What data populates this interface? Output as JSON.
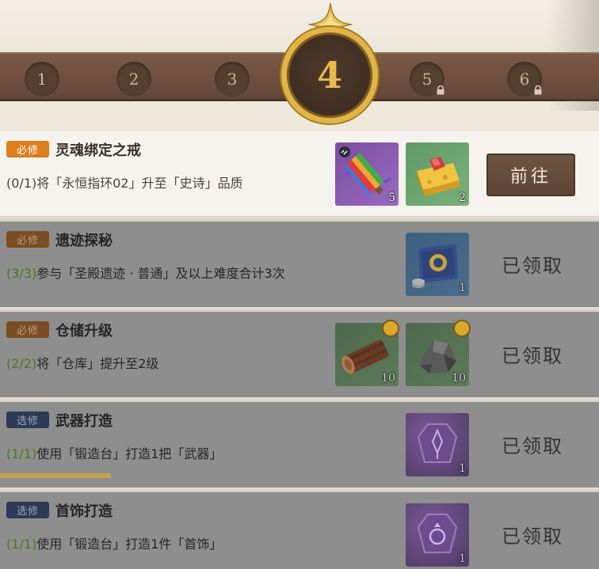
{
  "stages": [
    {
      "label": "1",
      "locked": false
    },
    {
      "label": "2",
      "locked": false
    },
    {
      "label": "3",
      "locked": false
    },
    {
      "label": "4",
      "locked": false,
      "current": true
    },
    {
      "label": "5",
      "locked": true
    },
    {
      "label": "6",
      "locked": true
    }
  ],
  "tasks": [
    {
      "tag": "必修",
      "title": "灵魂绑定之戒",
      "progress": "(0/1)",
      "description": "将「永恒指环02」升至「史诗」品质",
      "rewards": [
        {
          "icon": "rainbow-firework-icon",
          "qty": "5"
        },
        {
          "icon": "cheese-icon",
          "qty": "2"
        }
      ],
      "action": "前往"
    },
    {
      "tag": "必修",
      "title": "遗迹探秘",
      "progress": "(3/3)",
      "description": "参与「圣殿遗迹 · 普通」及以上难度合计3次",
      "rewards": [
        {
          "icon": "blue-banner-icon",
          "qty": "1"
        }
      ],
      "action": "已领取"
    },
    {
      "tag": "必修",
      "title": "仓储升级",
      "progress": "(2/2)",
      "description": "将「仓库」提升至2级",
      "rewards": [
        {
          "icon": "wood-log-icon",
          "qty": "10"
        },
        {
          "icon": "stone-ore-icon",
          "qty": "10"
        }
      ],
      "action": "已领取"
    },
    {
      "tag": "选修",
      "title": "武器打造",
      "progress": "(1/1)",
      "description": "使用「锻造台」打造1把「武器」",
      "rewards": [
        {
          "icon": "purple-weapon-blueprint-icon",
          "qty": "1"
        }
      ],
      "action": "已领取"
    },
    {
      "tag": "选修",
      "title": "首饰打造",
      "progress": "(1/1)",
      "description": "使用「锻造台」打造1件「首饰」",
      "rewards": [
        {
          "icon": "purple-jewelry-blueprint-icon",
          "qty": "1"
        }
      ],
      "action": "已领取"
    }
  ],
  "colors": {
    "required_tag": "#dc7e1c",
    "elective_tag": "#2c3a55",
    "stage_bar": "#6e4f3d",
    "current_ring": "#e0b545",
    "done_progress": "#4a7a1c"
  }
}
